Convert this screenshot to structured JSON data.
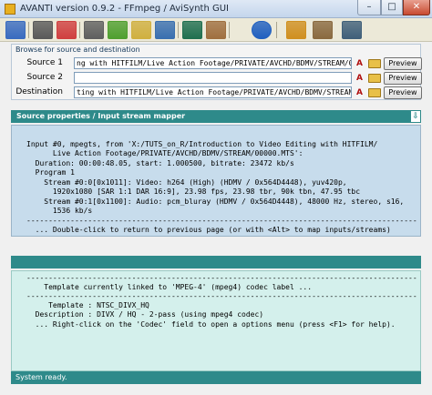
{
  "window": {
    "title": "AVANTI  version  0.9.2  -  FFmpeg / AviSynth GUI",
    "min_label": "–",
    "max_label": "□",
    "close_label": "✕"
  },
  "toolbar": {
    "icons": [
      {
        "name": "settings-icon",
        "color": "#3a6cc0"
      },
      {
        "name": "film-icon",
        "color": "#5a5a5a"
      },
      {
        "name": "image-icon",
        "color": "#d04040"
      },
      {
        "name": "ffmpeg-icon",
        "color": "#606060"
      },
      {
        "name": "avisynth-icon",
        "color": "#50a030"
      },
      {
        "name": "script-icon",
        "color": "#d0b040"
      },
      {
        "name": "filter-icon",
        "color": "#3a70b0"
      },
      {
        "name": "audio-icon",
        "color": "#207050"
      },
      {
        "name": "codec-icon",
        "color": "#a07040"
      },
      {
        "name": "refresh-icon",
        "color": "#2060c0"
      },
      {
        "name": "calculator-icon",
        "color": "#d09020"
      },
      {
        "name": "clipboard-icon",
        "color": "#8a6a40"
      },
      {
        "name": "monitor-icon",
        "color": "#40607a"
      }
    ]
  },
  "source": {
    "header": "Browse for source and destination",
    "rows": [
      {
        "label": "Source 1",
        "value": "ng with HITFILM/Live Action Footage/PRIVATE/AVCHD/BDMV/STREAM/00000.MTS",
        "preview": "Preview"
      },
      {
        "label": "Source 2",
        "value": "",
        "preview": "Preview"
      },
      {
        "label": "Destination",
        "value": "ting with HITFILM/Live Action Footage/PRIVATE/AVCHD/BDMV/STREAM/00000.avi",
        "preview": "Preview"
      }
    ],
    "a_glyph": "A"
  },
  "mapper": {
    "title": "Source properties / Input stream mapper",
    "arrow": "⇩",
    "lines": [
      "Input #0, mpegts, from 'X:/TUTS_on_R/Introduction to Video Editing with HITFILM/",
      "      Live Action Footage/PRIVATE/AVCHD/BDMV/STREAM/00000.MTS':",
      "  Duration: 00:00:48.05, start: 1.000500, bitrate: 23472 kb/s",
      "  Program 1",
      "    Stream #0:0[0x1011]: Video: h264 (High) (HDMV / 0x564D4448), yuv420p,",
      "      1920x1080 [SAR 1:1 DAR 16:9], 23.98 fps, 23.98 tbr, 90k tbn, 47.95 tbc",
      "    Stream #0:1[0x1100]: Audio: pcm_bluray (HDMV / 0x564D4448), 48000 Hz, stereo, s16,",
      "      1536 kb/s",
      "-----------------------------------------------------------------------------------------",
      "  ... Double-click to return to previous page (or with <Alt> to map inputs/streams)"
    ]
  },
  "template": {
    "lines": [
      "-----------------------------------------------------------------------------------------",
      "    Template currently linked to 'MPEG-4' (mpeg4) codec label ...",
      "-----------------------------------------------------------------------------------------",
      "     Template : NTSC_DIVX_HQ",
      "  Description : DIVX / HQ - 2-pass (using mpeg4 codec)",
      "  ... Right-click on the 'Codec' field to open a options menu (press <F1> for help)."
    ]
  },
  "status": {
    "text": "System ready."
  }
}
